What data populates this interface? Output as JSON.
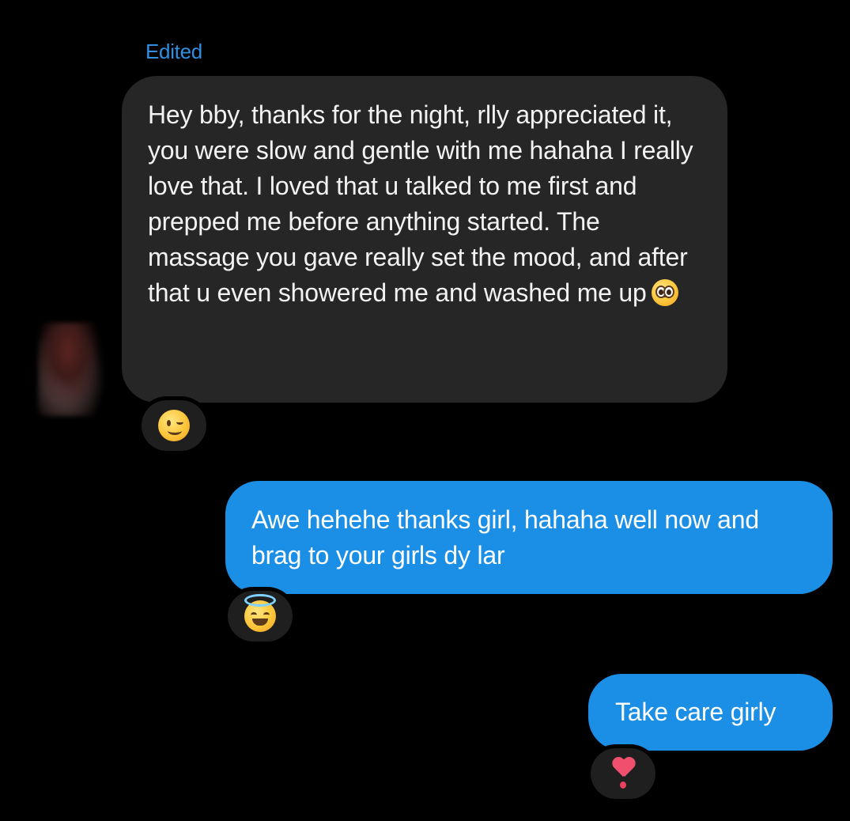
{
  "conversation": {
    "edited_label": "Edited",
    "incoming": {
      "avatar": "contact-avatar-blurred",
      "text": "Hey bby, thanks for the night, rlly appreciated it, you were slow and gentle with me hahaha I really love that. I loved that u talked to me first and prepped me before anything started. The massage you gave really set the mood, and after that u even showered me and washed me up",
      "inline_emoji": "pleading-face-icon",
      "reaction": "winking-face-icon"
    },
    "outgoing": [
      {
        "text": "Awe hehehe thanks girl, hahaha well now and brag to your girls dy lar",
        "reaction": "smiling-face-with-halo-icon"
      },
      {
        "text": "Take care girly",
        "reaction": "heart-exclamation-icon"
      }
    ],
    "colors": {
      "background": "#000000",
      "incoming_bubble": "#262626",
      "outgoing_bubble": "#1b8ee6",
      "edited_label": "#2f8fe0",
      "reaction_pill": "#1f1f1f"
    }
  }
}
